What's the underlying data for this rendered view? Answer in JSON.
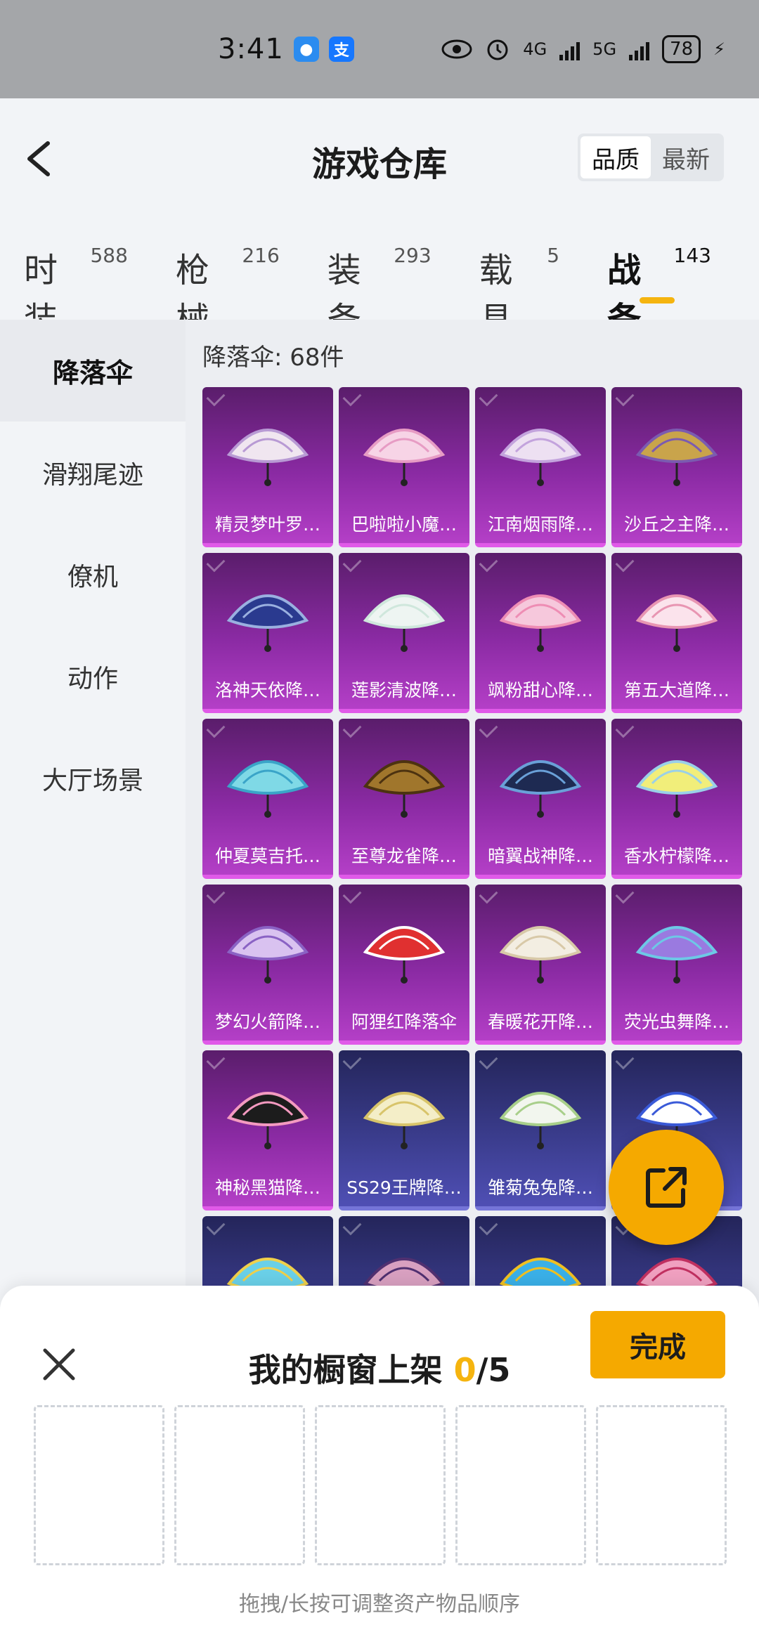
{
  "status_bar": {
    "time": "3:41",
    "battery": "78",
    "net1": "4G",
    "net2": "5G"
  },
  "header": {
    "title": "游戏仓库",
    "sort_options": [
      "品质",
      "最新"
    ],
    "sort_selected": "品质"
  },
  "categories": [
    {
      "name": "时装",
      "count": "588"
    },
    {
      "name": "枪械",
      "count": "216"
    },
    {
      "name": "装备",
      "count": "293"
    },
    {
      "name": "载具",
      "count": "5"
    },
    {
      "name": "战备",
      "count": "143"
    }
  ],
  "sidebar": [
    "降落伞",
    "滑翔尾迹",
    "僚机",
    "动作",
    "大厅场景"
  ],
  "content": {
    "count_label": "降落伞: 68件",
    "items": [
      {
        "name": "精灵梦叶罗…",
        "tier": "purple",
        "color1": "#f0e6f0",
        "color2": "#b89ad4"
      },
      {
        "name": "巴啦啦小魔…",
        "tier": "purple",
        "color1": "#f7d4e6",
        "color2": "#e79cc4"
      },
      {
        "name": "江南烟雨降…",
        "tier": "purple",
        "color1": "#ede0f2",
        "color2": "#c3a3dd"
      },
      {
        "name": "沙丘之主降…",
        "tier": "purple",
        "color1": "#c9a44b",
        "color2": "#7b5bb0"
      },
      {
        "name": "洛神天依降…",
        "tier": "purple",
        "color1": "#2a3a8f",
        "color2": "#9ab0e0"
      },
      {
        "name": "莲影清波降…",
        "tier": "purple",
        "color1": "#eef5f2",
        "color2": "#cfe7dc"
      },
      {
        "name": "飒粉甜心降…",
        "tier": "purple",
        "color1": "#f6c8dc",
        "color2": "#ee8db4"
      },
      {
        "name": "第五大道降…",
        "tier": "purple",
        "color1": "#fbe3ec",
        "color2": "#e895b2"
      },
      {
        "name": "仲夏莫吉托…",
        "tier": "purple",
        "color1": "#7fd9e6",
        "color2": "#3aa4c8"
      },
      {
        "name": "至尊龙雀降…",
        "tier": "purple",
        "color1": "#a0762c",
        "color2": "#4c3210"
      },
      {
        "name": "暗翼战神降…",
        "tier": "purple",
        "color1": "#1e2a52",
        "color2": "#6aa0d8"
      },
      {
        "name": "香水柠檬降…",
        "tier": "purple",
        "color1": "#f1ee7a",
        "color2": "#9ad0e8"
      },
      {
        "name": "梦幻火箭降…",
        "tier": "purple",
        "color1": "#d9c2f0",
        "color2": "#8a62c4"
      },
      {
        "name": "阿狸红降落伞",
        "tier": "purple",
        "color1": "#e03030",
        "color2": "#ffffff"
      },
      {
        "name": "春暖花开降…",
        "tier": "purple",
        "color1": "#f3eee2",
        "color2": "#d8c9a8"
      },
      {
        "name": "荧光虫舞降…",
        "tier": "purple",
        "color1": "#9a7ae0",
        "color2": "#6dc8e6"
      },
      {
        "name": "神秘黑猫降…",
        "tier": "purple",
        "color1": "#1c1c1c",
        "color2": "#f49ac0"
      },
      {
        "name": "SS29王牌降…",
        "tier": "blue",
        "color1": "#f4eec8",
        "color2": "#d8c46a"
      },
      {
        "name": "雏菊兔兔降…",
        "tier": "blue",
        "color1": "#f2f6ee",
        "color2": "#a8cf8a"
      },
      {
        "name": "",
        "tier": "blue",
        "color1": "#ffffff",
        "color2": "#3a5ad8"
      },
      {
        "name": "",
        "tier": "blue",
        "color1": "#6ad0e8",
        "color2": "#f0d04a"
      },
      {
        "name": "",
        "tier": "blue",
        "color1": "#d8a0c0",
        "color2": "#503070"
      },
      {
        "name": "",
        "tier": "blue",
        "color1": "#3ab0e8",
        "color2": "#f0c020"
      },
      {
        "name": "",
        "tier": "blue",
        "color1": "#f0a0c0",
        "color2": "#c03060"
      }
    ]
  },
  "sheet": {
    "title_prefix": "我的橱窗上架 ",
    "count": "0",
    "total": "/5",
    "done_label": "完成",
    "hint": "拖拽/长按可调整资产物品顺序"
  },
  "colors": {
    "accent": "#f5a900",
    "purple_tier": "#b43fc7",
    "blue_tier": "#4f4fb4"
  }
}
